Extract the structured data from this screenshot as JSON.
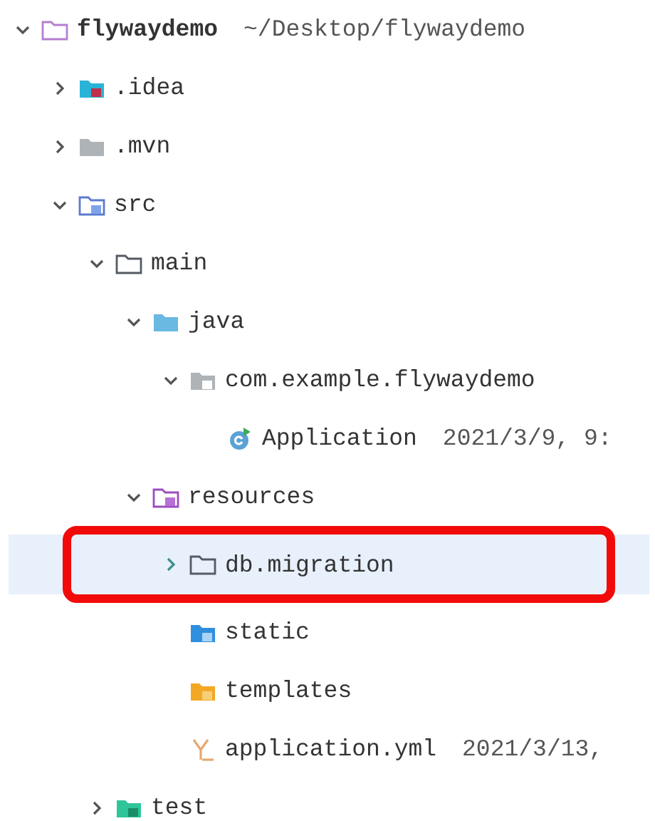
{
  "project_tree": [
    {
      "name": "flywaydemo",
      "detail": "~/Desktop/flywaydemo",
      "kind": "project",
      "expanded": true,
      "selected": false,
      "annotated": false,
      "children": [
        {
          "name": ".idea",
          "kind": "idea",
          "expanded": false,
          "selected": false,
          "annotated": false
        },
        {
          "name": ".mvn",
          "kind": "plain",
          "expanded": false,
          "selected": false,
          "annotated": false
        },
        {
          "name": "src",
          "kind": "source-root",
          "expanded": true,
          "selected": false,
          "annotated": false,
          "children": [
            {
              "name": "main",
              "kind": "folder",
              "expanded": true,
              "selected": false,
              "annotated": false,
              "children": [
                {
                  "name": "java",
                  "kind": "sources",
                  "expanded": true,
                  "selected": false,
                  "annotated": false,
                  "children": [
                    {
                      "name": "com.example.flywaydemo",
                      "kind": "package",
                      "expanded": true,
                      "selected": false,
                      "annotated": false,
                      "children": [
                        {
                          "name": "Application",
                          "detail": "2021/3/9, 9:",
                          "kind": "java-class",
                          "selected": false,
                          "annotated": false
                        }
                      ]
                    }
                  ]
                },
                {
                  "name": "resources",
                  "kind": "resources",
                  "expanded": true,
                  "selected": false,
                  "annotated": false,
                  "children": [
                    {
                      "name": "db.migration",
                      "kind": "folder",
                      "expanded": false,
                      "selected": true,
                      "annotated": true
                    },
                    {
                      "name": "static",
                      "kind": "web",
                      "selected": false,
                      "annotated": false
                    },
                    {
                      "name": "templates",
                      "kind": "templates",
                      "selected": false,
                      "annotated": false
                    },
                    {
                      "name": "application.yml",
                      "detail": "2021/3/13,",
                      "kind": "yaml",
                      "selected": false,
                      "annotated": false
                    }
                  ]
                }
              ]
            },
            {
              "name": "test",
              "kind": "test",
              "expanded": false,
              "selected": false,
              "annotated": false
            }
          ]
        }
      ]
    }
  ]
}
